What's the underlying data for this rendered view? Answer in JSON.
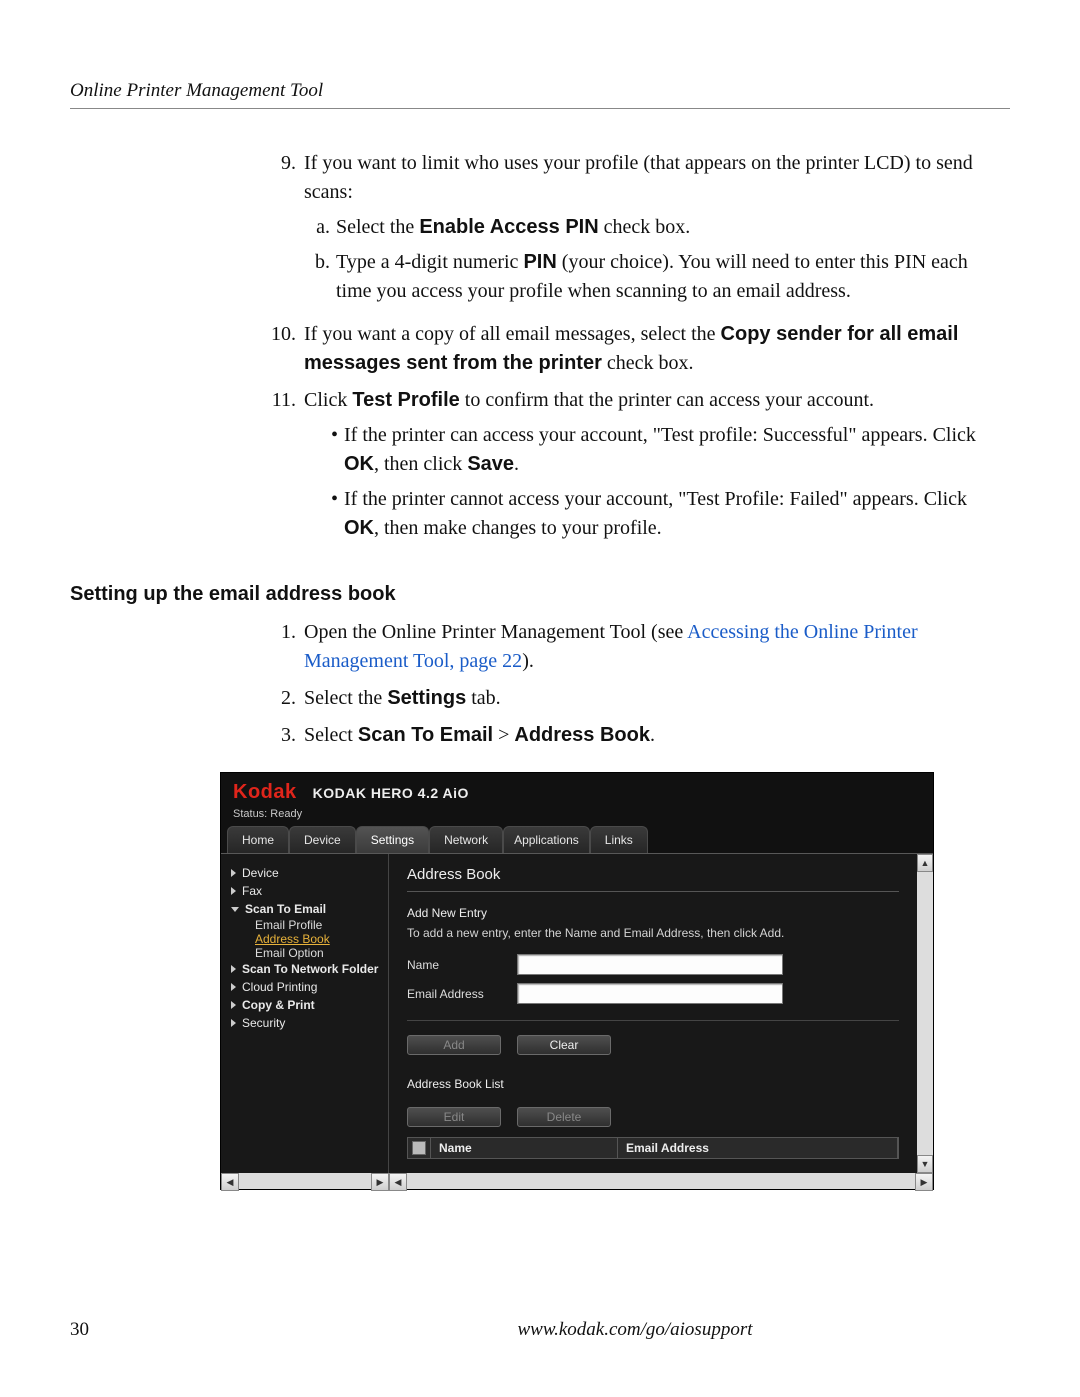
{
  "document": {
    "running_head": "Online Printer Management Tool",
    "page_number": "30",
    "footer_url": "www.kodak.com/go/aiosupport",
    "section_title": "Setting up the email address book",
    "steps9_intro": "If you want to limit who uses your profile (that appears on the printer LCD) to send scans:",
    "step9_num": "9.",
    "step9a_marker": "a.",
    "step9a_1": "Select the ",
    "step9a_b": "Enable Access PIN",
    "step9a_2": " check box.",
    "step9b_marker": "b.",
    "step9b_1": "Type a 4-digit numeric ",
    "step9b_b": "PIN",
    "step9b_2": " (your choice). You will need to enter this PIN each time you access your profile when scanning to an email address.",
    "step10_num": "10.",
    "step10_1": "If you want a copy of all email messages, select the ",
    "step10_b": "Copy sender for all email messages sent from the printer",
    "step10_2": " check box.",
    "step11_num": "11.",
    "step11_1": "Click ",
    "step11_b": "Test Profile",
    "step11_2": " to confirm that the printer can access your account.",
    "step11_b1_1": "If the printer can access your account, \"Test profile: Successful\" appears. Click ",
    "step11_b1_ok": "OK",
    "step11_b1_mid": ", then click ",
    "step11_b1_save": "Save",
    "step11_b1_end": ".",
    "step11_b2_1": "If the printer cannot access your account, \"Test Profile: Failed\" appears. Click ",
    "step11_b2_ok": "OK",
    "step11_b2_end": ", then make changes to your profile.",
    "setup1_num": "1.",
    "setup1_1": "Open the Online Printer Management Tool (see ",
    "setup1_link": "Accessing the Online Printer Management Tool, page 22",
    "setup1_end": ").",
    "setup2_num": "2.",
    "setup2_1": "Select the ",
    "setup2_b": "Settings",
    "setup2_2": " tab.",
    "setup3_num": "3.",
    "setup3_1": "Select ",
    "setup3_b1": "Scan To Email",
    "setup3_gt": " > ",
    "setup3_b2": "Address Book",
    "setup3_end": "."
  },
  "embed": {
    "brand": "Kodak",
    "model": "KODAK HERO 4.2 AiO",
    "status": "Status: Ready",
    "tabs": {
      "home": "Home",
      "device": "Device",
      "settings": "Settings",
      "network": "Network",
      "applications": "Applications",
      "links": "Links"
    },
    "sidebar": {
      "device": "Device",
      "fax": "Fax",
      "scan_to_email": "Scan To Email",
      "email_profile": "Email Profile",
      "address_book": "Address Book",
      "email_option": "Email Option",
      "scan_to_network": "Scan To Network Folder",
      "cloud_printing": "Cloud Printing",
      "copy_print": "Copy & Print",
      "security": "Security"
    },
    "content": {
      "title": "Address Book",
      "add_new_entry": "Add New Entry",
      "hint": "To add a new entry, enter the Name and Email Address, then click Add.",
      "label_name": "Name",
      "label_email": "Email Address",
      "name_value": "",
      "email_value": "",
      "btn_add": "Add",
      "btn_clear": "Clear",
      "list_title": "Address Book List",
      "btn_edit": "Edit",
      "btn_delete": "Delete",
      "col_name": "Name",
      "col_email": "Email Address"
    }
  }
}
